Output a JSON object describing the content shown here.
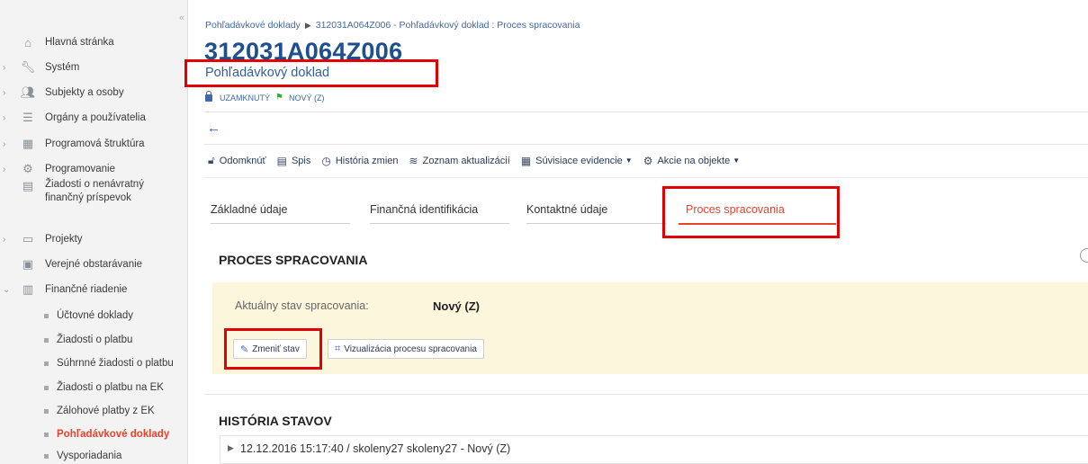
{
  "sidebar": {
    "items": [
      {
        "label": "Hlavná stránka",
        "icon": "home-icon",
        "chevron": ""
      },
      {
        "label": "Systém",
        "icon": "wrench-icon",
        "chevron": "›"
      },
      {
        "label": "Subjekty a osoby",
        "icon": "people-icon",
        "chevron": "›"
      },
      {
        "label": "Orgány a používatelia",
        "icon": "users-icon",
        "chevron": "›"
      },
      {
        "label": "Programová štruktúra",
        "icon": "structure-icon",
        "chevron": "›"
      },
      {
        "label": "Programovanie",
        "icon": "gear-icon",
        "chevron": "›"
      },
      {
        "label": "Žiadosti o nenávratný finančný príspevok",
        "icon": "document-icon",
        "chevron": ""
      },
      {
        "label": "Projekty",
        "icon": "folder-icon",
        "chevron": "›"
      },
      {
        "label": "Verejné obstarávanie",
        "icon": "cart-icon",
        "chevron": ""
      },
      {
        "label": "Finančné riadenie",
        "icon": "finance-icon",
        "chevron": "⌄"
      }
    ],
    "subitems": [
      {
        "label": "Účtovné doklady"
      },
      {
        "label": "Žiadosti o platbu"
      },
      {
        "label": "Súhrnné žiadosti o platbu"
      },
      {
        "label": "Žiadosti o platbu na EK"
      },
      {
        "label": "Zálohové platby z EK"
      },
      {
        "label": "Pohľadávkové doklady"
      },
      {
        "label": "Vysporiadania"
      }
    ]
  },
  "header": {
    "breadcrumb": [
      "Pohľadávkové doklady",
      "312031A064Z006 - Pohľadávkový doklad : Proces spracovania"
    ],
    "doc_id": "312031A064Z006",
    "doc_type": "Pohľadávkový doklad",
    "lock_status": "UZAMKNUTÝ",
    "state_status": "NOVÝ (Z)"
  },
  "toolbar": {
    "unlock": "Odomknúť",
    "file": "Spis",
    "history": "História zmien",
    "updates": "Zoznam aktualizácií",
    "related": "Súvisiace evidencie",
    "actions": "Akcie na objekte"
  },
  "tabs": [
    {
      "label": "Základné údaje"
    },
    {
      "label": "Finančná identifikácia"
    },
    {
      "label": "Kontaktné údaje"
    },
    {
      "label": "Proces spracovania"
    }
  ],
  "process": {
    "title": "PROCES SPRACOVANIA",
    "state_label": "Aktuálny stav spracovania:",
    "state_value": "Nový (Z)",
    "change_button": "Zmeniť stav",
    "visualize_button": "Vizualizácia procesu spracovania"
  },
  "history": {
    "title": "HISTÓRIA STAVOV",
    "entries": [
      "12.12.2016 15:17:40 / skoleny27 skoleny27 - Nový (Z)"
    ]
  },
  "colors": {
    "accent": "#e8412c",
    "primary": "#1e4f8f",
    "highlight_box": "#e00000",
    "panel": "#fcf6dc"
  }
}
